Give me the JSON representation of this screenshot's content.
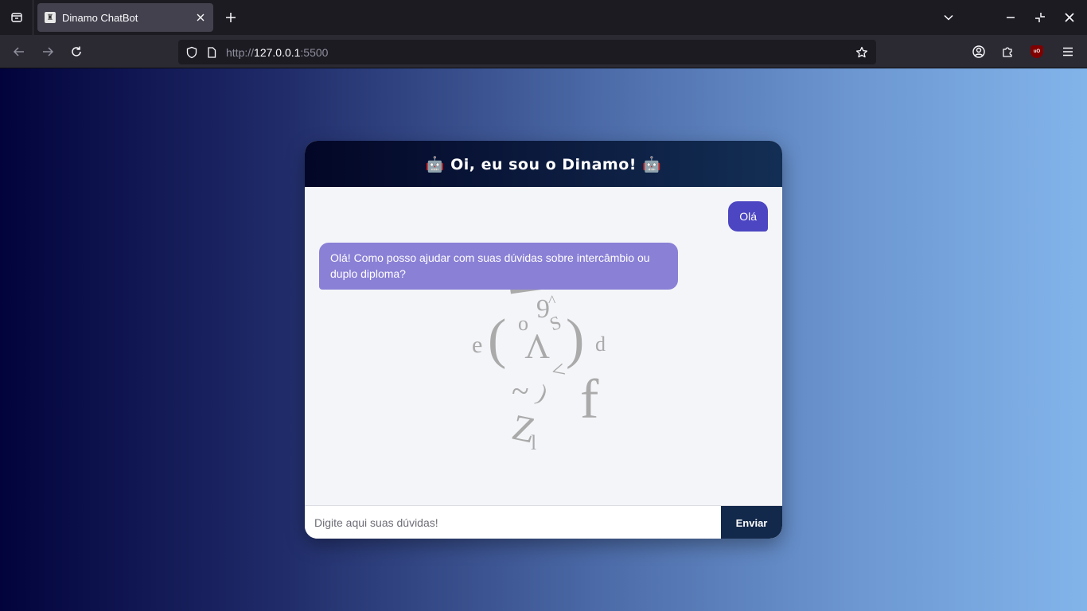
{
  "browser": {
    "tab_title": "Dinamo ChatBot",
    "url_scheme": "http://",
    "url_host": "127.0.0.1",
    "url_rest": ":5500"
  },
  "chat": {
    "header_title": "🤖 Oi, eu sou o Dinamo! 🤖",
    "messages": [
      {
        "from": "user",
        "text": "Olá"
      },
      {
        "from": "bot",
        "text": "Olá! Como posso ajudar com suas dúvidas sobre intercâmbio ou duplo diploma?"
      }
    ],
    "input_placeholder": "Digite aqui suas dúvidas!",
    "send_label": "Enviar"
  },
  "colors": {
    "header_gradient": [
      "#030626",
      "#132e54"
    ],
    "user_bubble": "#4c46c2",
    "bot_bubble": "#8a80d6",
    "send_button": "#13294b",
    "page_gradient": [
      "#02033c",
      "#82b4ea"
    ]
  }
}
